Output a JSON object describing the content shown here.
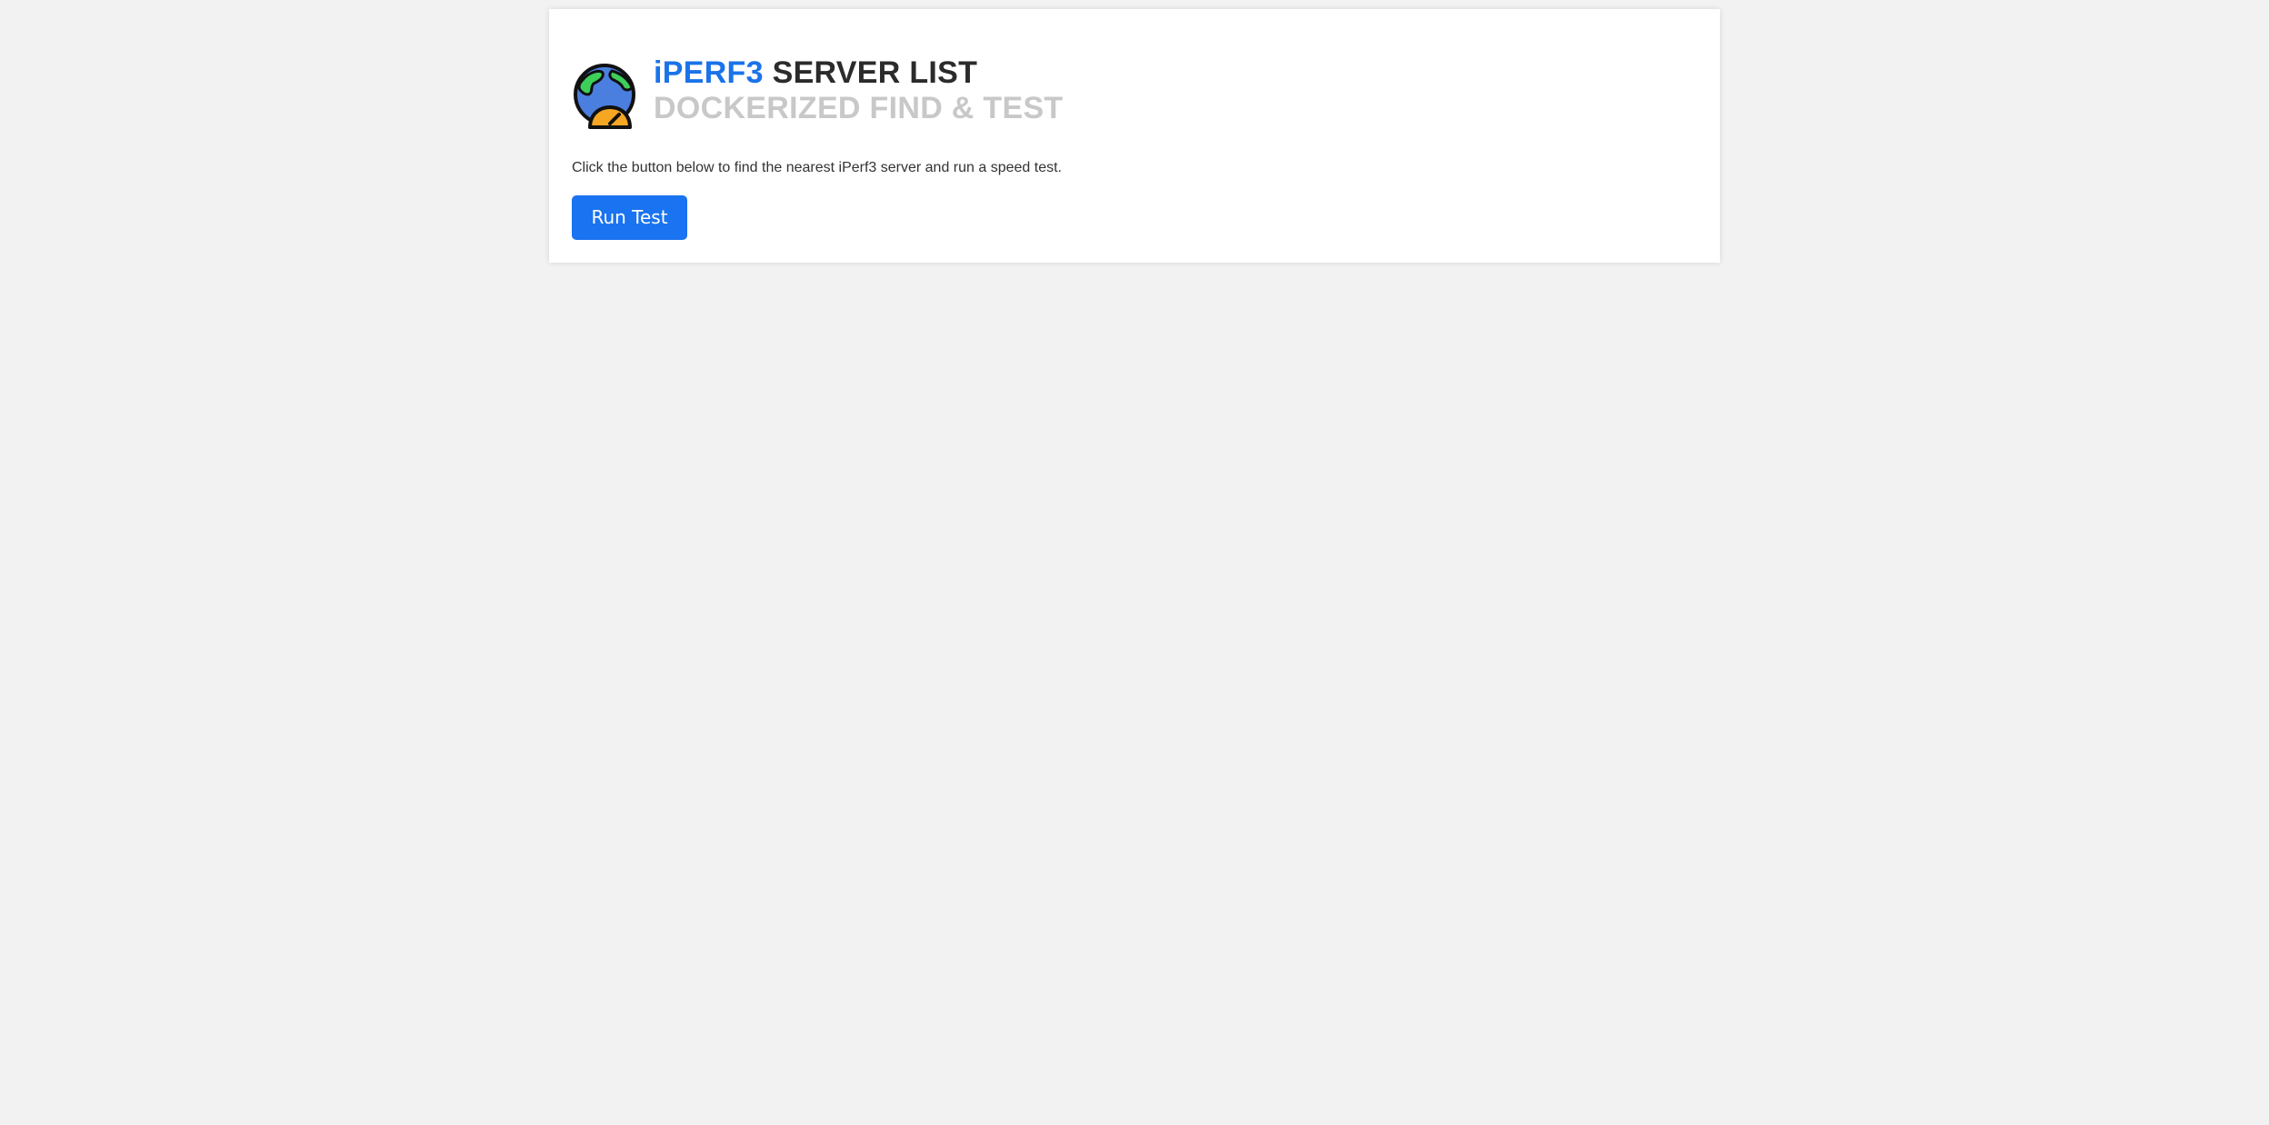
{
  "header": {
    "title_accent": "iPERF3",
    "title_main": "SERVER LIST",
    "subtitle": "DOCKERIZED FIND & TEST",
    "logo_icon": "globe-speedometer-icon"
  },
  "main": {
    "description": "Click the button below to find the nearest iPerf3 server and run a speed test.",
    "run_button_label": "Run Test"
  },
  "colors": {
    "accent": "#1a73e8",
    "button": "#1a73f0",
    "background": "#f2f2f2",
    "subtitle": "#c8c8c8"
  }
}
